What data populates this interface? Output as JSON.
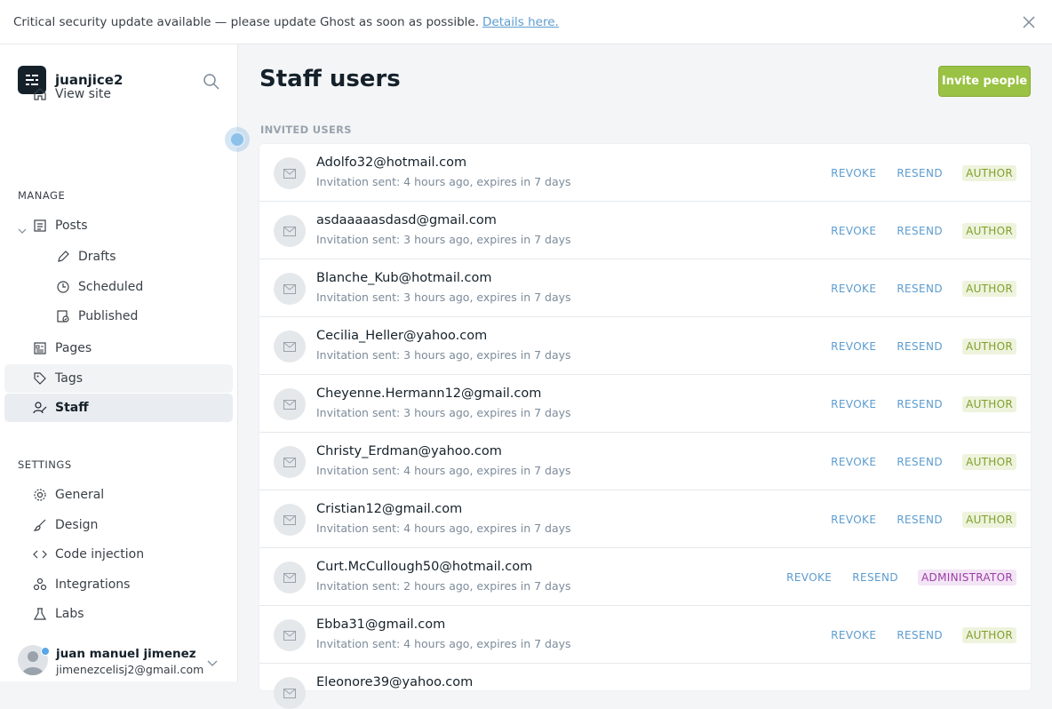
{
  "banner": {
    "text": "Critical security update available — please update Ghost as soon as possible.",
    "link": "Details here."
  },
  "sidebar": {
    "site_name": "juanjice2",
    "view_site": "View site",
    "manage_label": "MANAGE",
    "settings_label": "SETTINGS",
    "items": {
      "posts": "Posts",
      "drafts": "Drafts",
      "scheduled": "Scheduled",
      "published": "Published",
      "pages": "Pages",
      "tags": "Tags",
      "staff": "Staff",
      "general": "General",
      "design": "Design",
      "code_injection": "Code injection",
      "integrations": "Integrations",
      "labs": "Labs"
    },
    "user": {
      "name": "juan manuel jimenez",
      "email": "jimenezcelisj2@gmail.com"
    }
  },
  "main": {
    "title": "Staff users",
    "invite_button": "Invite people",
    "invited_label": "INVITED USERS",
    "revoke": "REVOKE",
    "resend": "RESEND",
    "invites": [
      {
        "email": "Adolfo32@hotmail.com",
        "meta": "Invitation sent: 4 hours ago, expires in 7 days",
        "role": "AUTHOR"
      },
      {
        "email": "asdaaaaasdasd@gmail.com",
        "meta": "Invitation sent: 3 hours ago, expires in 7 days",
        "role": "AUTHOR"
      },
      {
        "email": "Blanche_Kub@hotmail.com",
        "meta": "Invitation sent: 3 hours ago, expires in 7 days",
        "role": "AUTHOR"
      },
      {
        "email": "Cecilia_Heller@yahoo.com",
        "meta": "Invitation sent: 3 hours ago, expires in 7 days",
        "role": "AUTHOR"
      },
      {
        "email": "Cheyenne.Hermann12@gmail.com",
        "meta": "Invitation sent: 3 hours ago, expires in 7 days",
        "role": "AUTHOR"
      },
      {
        "email": "Christy_Erdman@yahoo.com",
        "meta": "Invitation sent: 4 hours ago, expires in 7 days",
        "role": "AUTHOR"
      },
      {
        "email": "Cristian12@gmail.com",
        "meta": "Invitation sent: 4 hours ago, expires in 7 days",
        "role": "AUTHOR"
      },
      {
        "email": "Curt.McCullough50@hotmail.com",
        "meta": "Invitation sent: 2 hours ago, expires in 7 days",
        "role": "ADMINISTRATOR"
      },
      {
        "email": "Ebba31@gmail.com",
        "meta": "Invitation sent: 4 hours ago, expires in 7 days",
        "role": "AUTHOR"
      },
      {
        "email": "Eleonore39@yahoo.com",
        "meta": "",
        "role": ""
      }
    ]
  }
}
